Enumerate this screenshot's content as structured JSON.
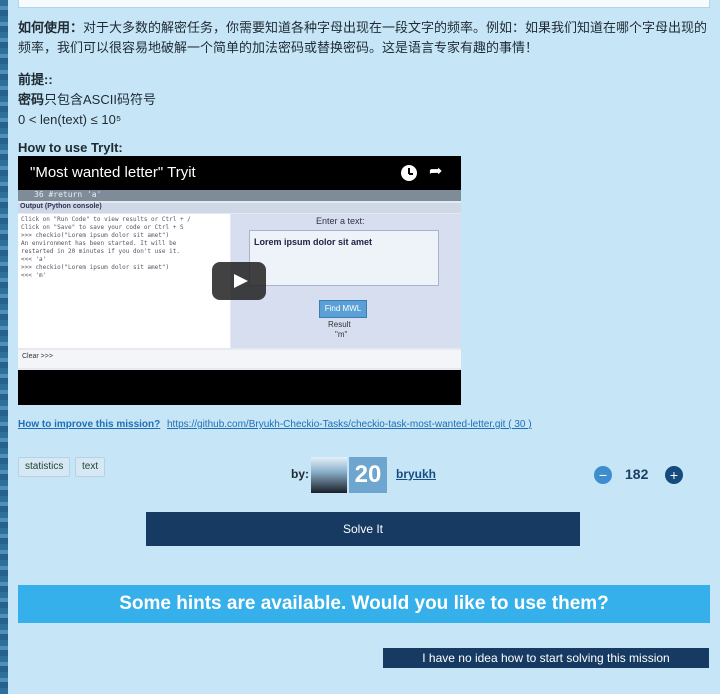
{
  "usage": {
    "label": "如何使用：",
    "text": "对于大多数的解密任务，你需要知道各种字母出现在一段文字的频率。例如：如果我们知道在哪个字母出现的频率，我们可以很容易地破解一个简单的加法密码或替换密码。这是语言专家有趣的事情！"
  },
  "preconditions": {
    "title": "前提::",
    "line1_bold": "密码",
    "line1_rest": "只包含ASCII码符号",
    "line2": "0 < len(text) ≤ 10⁵"
  },
  "howto": {
    "title": "How to use TryIt:"
  },
  "video": {
    "title": "\"Most wanted letter\" Tryit",
    "code_line": "36     #return 'a'",
    "console_header": "Output (Python console)",
    "console_text": "Click on \"Run Code\" to view results or Ctrl + /\nClick on \"Save\" to save your code or Ctrl + S\n>>> checkio(\"Lorem ipsum dolor sit amet\")\nAn environment has been started. It will be\nrestarted in 20 minutes if you don't use it.\n<<< 'a'\n>>> checkio(\"Lorem ipsum dolor sit amet\")\n<<< 'm'",
    "enter_text": "Enter a text:",
    "sample_text": "Lorem ipsum dolor sit amet",
    "find_button": "Find MWL",
    "result_label": "Result",
    "result_value": "\"m\"",
    "clear_label": "Clear  >>>"
  },
  "links": {
    "improve": "How to improve this mission?",
    "repo": "https://github.com/Bryukh-Checkio-Tasks/checkio-task-most-wanted-letter.git ( 30 )"
  },
  "tags": [
    "statistics",
    "text"
  ],
  "author": {
    "by_label": "by:",
    "level": "20",
    "username": "bryukh"
  },
  "votes": {
    "count": "182",
    "down_label": "−",
    "up_label": "+"
  },
  "solve_label": "Solve It",
  "hints_text": "Some hints are available. Would you like to use them?",
  "no_idea_label": "I have no idea how to start solving this mission",
  "colors": {
    "background": "#c6e6f7",
    "accent": "#36b0ea",
    "dark": "#173a63"
  }
}
